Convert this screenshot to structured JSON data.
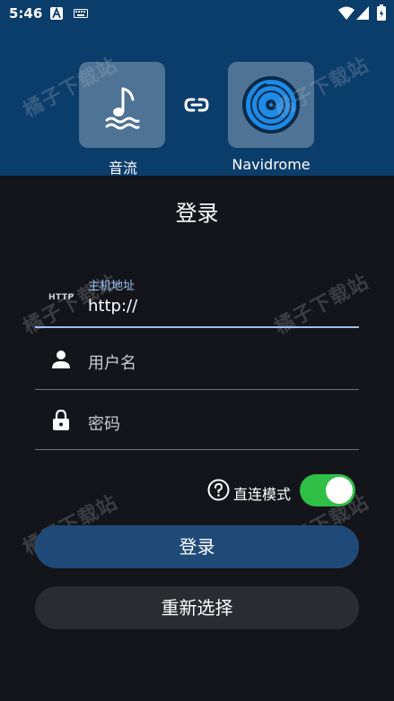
{
  "status_bar": {
    "time": "5:46",
    "icons": [
      "a-badge-icon",
      "keyboard-icon",
      "wifi-icon",
      "signal-icon",
      "battery-icon"
    ]
  },
  "header": {
    "source_app": {
      "name": "音流",
      "icon": "music-note-waves-icon"
    },
    "target_app": {
      "name": "Navidrome",
      "icon": "vinyl-record-icon"
    },
    "link_icon": "link-icon",
    "background_color": "#0b3d6b"
  },
  "watermark": "橘子下载站",
  "form": {
    "title": "登录",
    "host": {
      "label": "主机地址",
      "prefix": "HTTP",
      "value": "http://"
    },
    "username": {
      "placeholder": "用户名"
    },
    "password": {
      "placeholder": "密码"
    },
    "direct_mode": {
      "label": "直连模式",
      "enabled": true
    }
  },
  "buttons": {
    "login": "登录",
    "reselect": "重新选择"
  },
  "colors": {
    "accent": "#9ec2f0",
    "toggle_on": "#2fbf47",
    "login_button": "#1f4a78",
    "background": "#13151a"
  }
}
